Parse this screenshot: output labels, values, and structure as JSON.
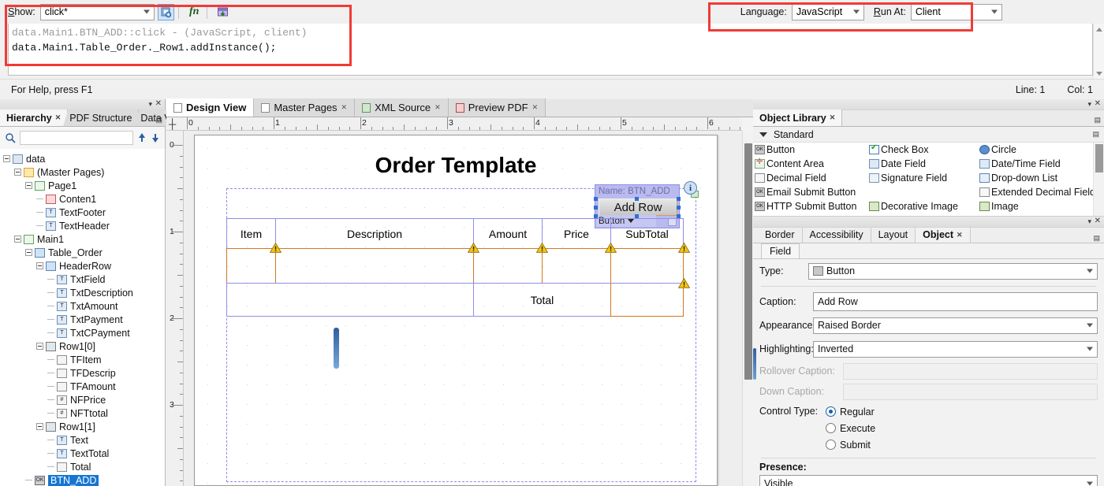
{
  "script_editor": {
    "show_label": "Show:",
    "show_value": "click*",
    "toolbar_icons": [
      "insert-reference-icon",
      "function-builder-icon",
      "palette-icon"
    ],
    "language_label": "Language:",
    "language_value": "JavaScript",
    "runat_label": "Run At:",
    "runat_value": "Client",
    "code_header": "data.Main1.BTN_ADD::click - (JavaScript, client)",
    "code_body": "data.Main1.Table_Order._Row1.addInstance();",
    "help_text": "For Help, press F1",
    "line_status": "Line: 1",
    "col_status": "Col: 1"
  },
  "hierarchy": {
    "tabs": [
      {
        "label": "Hierarchy",
        "closable": true,
        "active": true
      },
      {
        "label": "PDF Structure",
        "closable": false,
        "active": false
      },
      {
        "label": "Data View",
        "closable": false,
        "active": false
      }
    ],
    "search_placeholder": "",
    "search_value": "",
    "nodes": [
      {
        "label": "data",
        "depth": 0,
        "icon": "data",
        "expandable": true,
        "selected": false
      },
      {
        "label": "(Master Pages)",
        "depth": 1,
        "icon": "master",
        "expandable": true,
        "selected": false
      },
      {
        "label": "Page1",
        "depth": 2,
        "icon": "page",
        "expandable": true,
        "selected": false
      },
      {
        "label": "Conten1",
        "depth": 3,
        "icon": "conten",
        "expandable": false,
        "selected": false
      },
      {
        "label": "TextFooter",
        "depth": 3,
        "icon": "text",
        "expandable": false,
        "selected": false
      },
      {
        "label": "TextHeader",
        "depth": 3,
        "icon": "text",
        "expandable": false,
        "selected": false
      },
      {
        "label": "Main1",
        "depth": 1,
        "icon": "page",
        "expandable": true,
        "selected": false
      },
      {
        "label": "Table_Order",
        "depth": 2,
        "icon": "tablei",
        "expandable": true,
        "selected": false
      },
      {
        "label": "HeaderRow",
        "depth": 3,
        "icon": "tablei",
        "expandable": true,
        "selected": false
      },
      {
        "label": "TxtField",
        "depth": 4,
        "icon": "text",
        "expandable": false,
        "selected": false
      },
      {
        "label": "TxtDescription",
        "depth": 4,
        "icon": "text",
        "expandable": false,
        "selected": false
      },
      {
        "label": "TxtAmount",
        "depth": 4,
        "icon": "text",
        "expandable": false,
        "selected": false
      },
      {
        "label": "TxtPayment",
        "depth": 4,
        "icon": "text",
        "expandable": false,
        "selected": false
      },
      {
        "label": "TxtCPayment",
        "depth": 4,
        "icon": "text",
        "expandable": false,
        "selected": false
      },
      {
        "label": "Row1[0]",
        "depth": 3,
        "icon": "rowi",
        "expandable": true,
        "selected": false
      },
      {
        "label": "TFItem",
        "depth": 4,
        "icon": "field",
        "expandable": false,
        "selected": false
      },
      {
        "label": "TFDescrip",
        "depth": 4,
        "icon": "field",
        "expandable": false,
        "selected": false
      },
      {
        "label": "TFAmount",
        "depth": 4,
        "icon": "field",
        "expandable": false,
        "selected": false
      },
      {
        "label": "NFPrice",
        "depth": 4,
        "icon": "num",
        "expandable": false,
        "selected": false
      },
      {
        "label": "NFTtotal",
        "depth": 4,
        "icon": "num",
        "expandable": false,
        "selected": false
      },
      {
        "label": "Row1[1]",
        "depth": 3,
        "icon": "rowi",
        "expandable": true,
        "selected": false
      },
      {
        "label": "Text",
        "depth": 4,
        "icon": "text",
        "expandable": false,
        "selected": false
      },
      {
        "label": "TextTotal",
        "depth": 4,
        "icon": "text",
        "expandable": false,
        "selected": false
      },
      {
        "label": "Total",
        "depth": 4,
        "icon": "field",
        "expandable": false,
        "selected": false
      },
      {
        "label": "BTN_ADD",
        "depth": 2,
        "icon": "btn",
        "expandable": false,
        "selected": true
      }
    ]
  },
  "design": {
    "tabs": [
      {
        "label": "Design View",
        "closable": false,
        "active": true,
        "icon": "document-icon"
      },
      {
        "label": "Master Pages",
        "closable": true,
        "active": false,
        "icon": "document-icon"
      },
      {
        "label": "XML Source",
        "closable": true,
        "active": false,
        "icon": "xml-icon"
      },
      {
        "label": "Preview PDF",
        "closable": true,
        "active": false,
        "icon": "pdf-icon"
      }
    ],
    "h_ruler_ticks": [
      "0",
      "1",
      "2",
      "3",
      "4",
      "5",
      "6"
    ],
    "v_ruler_ticks": [
      "0",
      "1",
      "2",
      "3"
    ],
    "page_title": "Order Template",
    "button_widget": {
      "name_label": "Name: BTN_ADD",
      "caption": "Add Row",
      "type_label": "Button"
    },
    "table": {
      "headers": [
        "Item",
        "Description",
        "Amount",
        "Price",
        "SubTotal"
      ],
      "total_label": "Total",
      "warning_count": 6
    }
  },
  "object_library": {
    "tab_label": "Object Library",
    "category": "Standard",
    "items": [
      {
        "label": "Button",
        "icon": "button-icon",
        "col": 0,
        "row": 0
      },
      {
        "label": "Check Box",
        "icon": "checkbox-icon",
        "col": 1,
        "row": 0
      },
      {
        "label": "Circle",
        "icon": "circle-icon",
        "col": 2,
        "row": 0
      },
      {
        "label": "Content Area",
        "icon": "content-area-icon",
        "col": 0,
        "row": 1
      },
      {
        "label": "Date Field",
        "icon": "date-field-icon",
        "col": 1,
        "row": 1
      },
      {
        "label": "Date/Time Field",
        "icon": "datetime-field-icon",
        "col": 2,
        "row": 1
      },
      {
        "label": "Decimal Field",
        "icon": "decimal-field-icon",
        "col": 0,
        "row": 2
      },
      {
        "label": "Signature Field",
        "icon": "signature-field-icon",
        "col": 1,
        "row": 2
      },
      {
        "label": "Drop-down List",
        "icon": "dropdown-list-icon",
        "col": 2,
        "row": 2
      },
      {
        "label": "Email Submit Button",
        "icon": "button-icon",
        "col": 0,
        "row": 3
      },
      {
        "label": "Extended Decimal Field",
        "icon": "decimal-field-icon",
        "col": 2,
        "row": 3
      },
      {
        "label": "HTTP Submit Button",
        "icon": "button-icon",
        "col": 0,
        "row": 4
      },
      {
        "label": "Decorative Image",
        "icon": "image-icon",
        "col": 1,
        "row": 4
      },
      {
        "label": "Image",
        "icon": "image-icon",
        "col": 2,
        "row": 4
      }
    ]
  },
  "object_props": {
    "tabs": [
      {
        "label": "Border",
        "active": false,
        "closable": false
      },
      {
        "label": "Accessibility",
        "active": false,
        "closable": false
      },
      {
        "label": "Layout",
        "active": false,
        "closable": false
      },
      {
        "label": "Object",
        "active": true,
        "closable": true
      }
    ],
    "subtab": "Field",
    "type_label": "Type:",
    "type_value": "Button",
    "caption_label": "Caption:",
    "caption_value": "Add Row",
    "appearance_label": "Appearance:",
    "appearance_value": "Raised Border",
    "highlighting_label": "Highlighting:",
    "highlighting_value": "Inverted",
    "rollover_caption_label": "Rollover Caption:",
    "rollover_caption_value": "",
    "down_caption_label": "Down Caption:",
    "down_caption_value": "",
    "control_type_label": "Control Type:",
    "control_type_options": [
      {
        "label": "Regular",
        "selected": true
      },
      {
        "label": "Execute",
        "selected": false
      },
      {
        "label": "Submit",
        "selected": false
      }
    ],
    "presence_label": "Presence:",
    "presence_value": "Visible"
  },
  "colors": {
    "annotation_red": "#ef3b36",
    "selection_blue": "#1675d1",
    "subform_purple": "#8e8ee8",
    "table_orange": "#d07820",
    "warning_yellow": "#f5c518"
  }
}
